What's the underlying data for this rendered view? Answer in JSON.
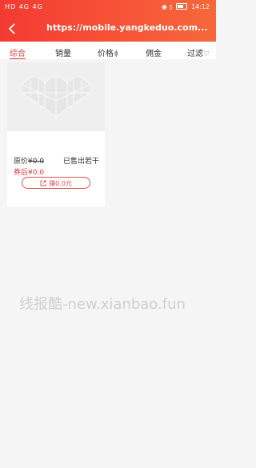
{
  "status_bar": {
    "left_text": "HD 4G 4G",
    "time": "14:12"
  },
  "header": {
    "url": "https://mobile.yangkeduo.com..."
  },
  "tabs": [
    {
      "label": "综合",
      "active": true
    },
    {
      "label": "销量",
      "active": false
    },
    {
      "label": "价格",
      "active": false
    },
    {
      "label": "佣金",
      "active": false
    },
    {
      "label": "过滤",
      "active": false
    }
  ],
  "product": {
    "original_price_label": "原价",
    "original_price": "¥0.0",
    "sold_text": "已售出若干",
    "after_coupon_label": "券后",
    "after_coupon_price": "¥0.0",
    "earn_button": "赚0.0元"
  },
  "watermark": "线报酷-new.xianbao.fun",
  "colors": {
    "accent": "#e4393c",
    "header_start": "#f43a32",
    "header_end": "#f7683b"
  }
}
